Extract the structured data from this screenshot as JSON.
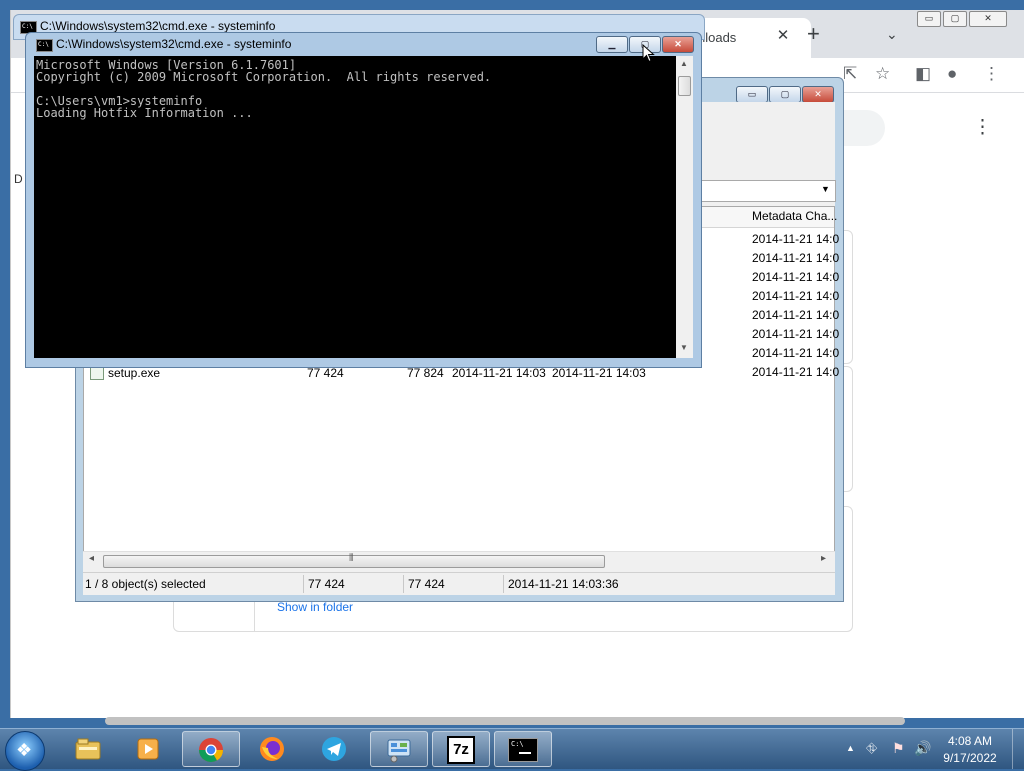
{
  "chrome": {
    "tab_title": "nloads",
    "tab_close": "✕",
    "new_tab": "+",
    "tab_list": "⌄",
    "window_min": "▭",
    "window_max": "▢",
    "window_close": "✕",
    "share_icon": "⇱",
    "bookmark_icon": "☆",
    "sidepanel_icon": "◧",
    "profile_icon": "●",
    "menu_dots": "⋮",
    "left_letter": "D",
    "download_link": "Show in folder"
  },
  "sevenzip": {
    "window_min": "▭",
    "window_max": "▢",
    "window_close": "✕",
    "combo_arrow": "▼",
    "column_metadata": "Metadata Cha...",
    "metadata_times": [
      "2014-11-21 14:0",
      "2014-11-21 14:0",
      "2014-11-21 14:0",
      "2014-11-21 14:0",
      "2014-11-21 14:0",
      "2014-11-21 14:0",
      "2014-11-21 14:0",
      "2014-11-21 14:0"
    ],
    "visible_row": {
      "name": "setup.exe",
      "size": "77 424",
      "packed": "77 824",
      "modified": "2014-11-21 14:03",
      "created": "2014-11-21 14:03",
      "metadata": "2014-11-21 14:0"
    },
    "scroll_left": "◂",
    "scroll_right": "▸",
    "scroll_grip": "⦀",
    "status": {
      "selection": "1 / 8 object(s) selected",
      "size": "77 424",
      "packed": "77 424",
      "datetime": "2014-11-21 14:03:36"
    }
  },
  "cmd": {
    "ghost_title": "C:\\Windows\\system32\\cmd.exe - systeminfo",
    "title": "C:\\Windows\\system32\\cmd.exe - systeminfo",
    "icon_text": "C:\\",
    "window_min": "▁",
    "window_max": "▢",
    "window_close": "✕",
    "console_text": "Microsoft Windows [Version 6.1.7601]\nCopyright (c) 2009 Microsoft Corporation.  All rights reserved.\n\nC:\\Users\\vm1>systeminfo\nLoading Hotfix Information ...",
    "scroll_up": "▲",
    "scroll_down": "▼"
  },
  "taskbar": {
    "start_logo": "❖",
    "apps": [
      {
        "name": "Windows Explorer",
        "active": false
      },
      {
        "name": "Windows Media Player",
        "active": false
      },
      {
        "name": "Google Chrome",
        "active": true
      },
      {
        "name": "Firefox",
        "active": false
      },
      {
        "name": "Telegram",
        "active": false
      },
      {
        "name": "Control Panel",
        "active": true
      },
      {
        "name": "7-Zip",
        "active": true
      },
      {
        "name": "Command Prompt",
        "active": true
      }
    ],
    "sevenzip_label": "7z",
    "cmd_label": "C:\\",
    "tray_arrow": "▲",
    "tray_network": "⛗",
    "tray_flag": "⚑",
    "tray_volume": "🔊",
    "clock_time": "4:08 AM",
    "clock_date": "9/17/2022",
    "colors": {
      "taskbar": "#2f5680",
      "console_bg": "#000000",
      "console_fg": "#c0c0c0",
      "chrome_link": "#1a73e8"
    }
  }
}
